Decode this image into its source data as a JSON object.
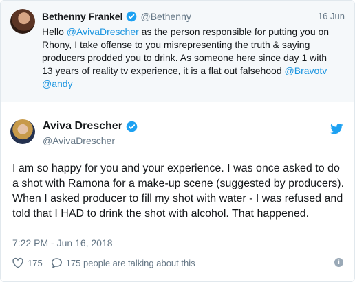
{
  "quoted_tweet": {
    "author_name": "Bethenny Frankel",
    "author_handle": "@Bethenny",
    "date": "16 Jun",
    "text_before": "Hello ",
    "mention": "@AvivaDrescher",
    "text_after": " as the person responsible for putting you on Rhony, I take offense to you misrepresenting the truth & saying producers prodded you to drink. As someone here since day 1 with 13 years of reality tv experience, it is a flat out falsehood ",
    "trailing_mentions": [
      "@Bravotv",
      "@andy"
    ]
  },
  "tweet": {
    "author_name": "Aviva Drescher",
    "author_handle": "@AvivaDrescher",
    "text": "I am so happy for you and your experience. I was once asked to do a shot with Ramona for a make-up scene (suggested by producers). When I asked producer to fill my shot with water - I was refused and told that I HAD to drink the shot with alcohol. That happened.",
    "timestamp": "7:22 PM - Jun 16, 2018",
    "likes": "175",
    "conversation": "175 people are talking about this"
  },
  "icons": {
    "verified": "verified-badge-icon",
    "brand": "twitter-bird-icon",
    "like": "heart-icon",
    "reply": "speech-bubble-icon",
    "info": "info-icon"
  },
  "colors": {
    "verified": "#1da1f2",
    "link": "#1b95e0",
    "muted": "#657786",
    "quoted_bg": "#f5f8fa"
  }
}
